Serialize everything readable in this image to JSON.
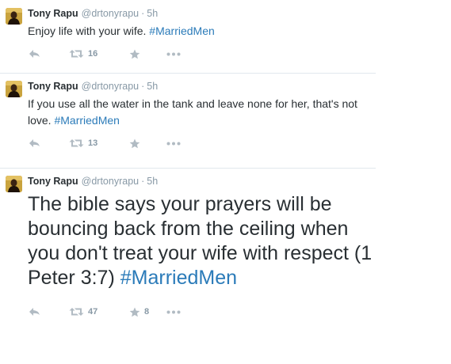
{
  "tweets": [
    {
      "fullname": "Tony Rapu",
      "username": "@drtonyrapu",
      "separator": "·",
      "time": "5h",
      "text": "Enjoy life with your wife.",
      "hashtag": "#MarriedMen",
      "retweets": "16",
      "favorites": ""
    },
    {
      "fullname": "Tony Rapu",
      "username": "@drtonyrapu",
      "separator": "·",
      "time": "5h",
      "text": "If you use all the water in the tank and leave none for her, that's not love.",
      "hashtag": "#MarriedMen",
      "retweets": "13",
      "favorites": ""
    },
    {
      "fullname": "Tony Rapu",
      "username": "@drtonyrapu",
      "separator": "·",
      "time": "5h",
      "text": "The bible says your prayers will be bouncing back from the ceiling when you don't treat your wife with respect (1 Peter 3:7)",
      "hashtag": "#MarriedMen",
      "retweets": "47",
      "favorites": "8"
    }
  ],
  "icons": {
    "reply": "reply-icon",
    "retweet": "retweet-icon",
    "favorite": "star-icon",
    "more": "more-icon"
  },
  "colors": {
    "hashtag": "#2b7bb9",
    "text": "#292f33",
    "muted": "#8899a6",
    "icon": "#b1bbc3",
    "divider": "#e1e8ed"
  }
}
